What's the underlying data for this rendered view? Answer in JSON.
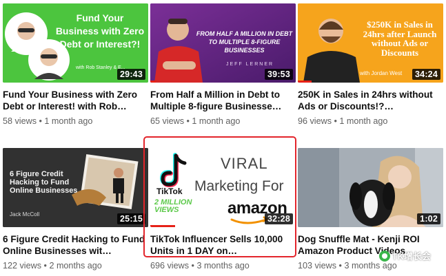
{
  "videos": [
    {
      "title": "Fund Your Business with Zero Debt or Interest! with Rob…",
      "duration": "29:43",
      "views": "58 views",
      "age": "1 month ago",
      "thumb_text": "Fund Your Business with Zero Debt or Interest?!",
      "thumb_sub": "with Rob Stanley & E..."
    },
    {
      "title": "From Half a Million in Debt to Multiple 8-figure Businesse…",
      "duration": "39:53",
      "views": "65 views",
      "age": "1 month ago",
      "thumb_text": "FROM HALF A MILLION IN DEBT TO MULTIPLE 8-FIGURE BUSINESSES",
      "thumb_sub": "JEFF LERNER"
    },
    {
      "title": "250K in Sales in 24hrs without Ads or Discounts!?…",
      "duration": "34:24",
      "views": "96 views",
      "age": "1 month ago",
      "thumb_text": "$250K in Sales in 24hrs after Launch without Ads or Discounts",
      "thumb_sub": "with Jordan West"
    },
    {
      "title": "6 Figure Credit Hacking to Fund Online Businesses wit…",
      "duration": "25:15",
      "views": "122 views",
      "age": "2 months ago",
      "thumb_text": "6 Figure Credit Hacking to Fund Online Businesses",
      "thumb_sub": "Jack McColl"
    },
    {
      "title": "TikTok Influencer Sells 10,000 Units in 1 DAY on…",
      "duration": "32:28",
      "views": "696 views",
      "age": "3 months ago",
      "thumb_viral": "VIRAL",
      "thumb_marketing": "Marketing For",
      "thumb_tiktok": "TikTok",
      "thumb_millions": "2 MILLION VIEWS",
      "thumb_amazon": "amazon"
    },
    {
      "title": "Dog Snuffle Mat - Kenji ROI Amazon Product Videos",
      "duration": "1:02",
      "views": "103 views",
      "age": "3 months ago"
    }
  ],
  "separator": "•",
  "watermark": "TK增长会",
  "colors": {
    "progress": "#e62117",
    "highlight": "#e3242b",
    "green_thumb": "#49c43b",
    "purple_thumb": "#6a2a86",
    "orange_thumb": "#f4a11b"
  }
}
